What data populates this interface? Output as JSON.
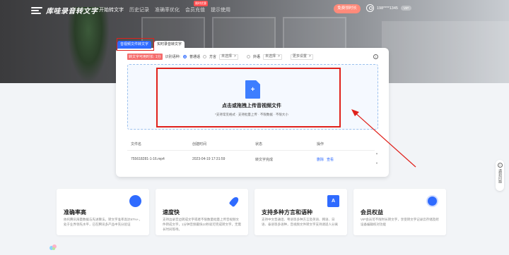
{
  "header": {
    "brand": "库哇录音转文字",
    "nav": [
      {
        "label": "开始转文字",
        "active": true
      },
      {
        "label": "历史记录",
        "active": false
      },
      {
        "label": "准确率优化",
        "active": false
      },
      {
        "label": "会员充值",
        "active": false,
        "badge": "限时优惠"
      },
      {
        "label": "提示使用",
        "active": false
      }
    ],
    "vip_button": "免费领时长",
    "user_phone": "198****1345",
    "user_tag": "VIP"
  },
  "tabs": [
    "音视频文件转文字",
    "实时录音转文字"
  ],
  "options": {
    "quota": "转文字可用时长: 1分",
    "lang_label": "识别语种:",
    "radio_putong": "普通话",
    "radio_fangyan": "方言",
    "fangyan_select": "未选择",
    "waiyu_label": "外语",
    "waiyu_select": "未选择",
    "more_settings": "更多设置"
  },
  "upload": {
    "icon": "+",
    "title": "点击或拖拽上传音视频文件",
    "subtitle": "*支持常见格式 · 支持批量上传 · 不限数据 · 不限大小"
  },
  "file_list": {
    "columns": [
      "文件名",
      "创建时间",
      "状态",
      "操作"
    ],
    "rows": [
      {
        "name": "755618281-1-16.mp4",
        "created": "2023-04-19 17:31:59",
        "status": "转文字完成",
        "action_delete": "删除",
        "action_view": "查看"
      }
    ]
  },
  "features": [
    {
      "title": "准确率高",
      "desc": "依托腾讯海量数据与先进算法，转文字准率高达97%+，处于业界领先水平，已在腾讯多产品中充分验证",
      "icon": "target-icon"
    },
    {
      "title": "速度快",
      "desc": "支持边录音边转成文字或者不限数量批量上传音视频文件转成文字，1分钟音频最快10秒就可完成转文字，无需长时间等待。",
      "icon": "rocket-icon"
    },
    {
      "title": "支持多种方言和语种",
      "desc": "支持中文普通话、粤语等多种方言及英语、韩语、日语、泰语等多语种，音视频文件转文字支持调适人分离",
      "icon": "language-icon"
    },
    {
      "title": "会员权益",
      "desc": "VIP会员可不限时长转文字，享受转文字记录云存储及跨设备编辑校对功能",
      "icon": "medal-icon"
    }
  ],
  "side_widget": "遇到问题",
  "colors": {
    "accent": "#2f6bff",
    "highlight": "#e0211b",
    "vip": "#ff8a7a"
  }
}
